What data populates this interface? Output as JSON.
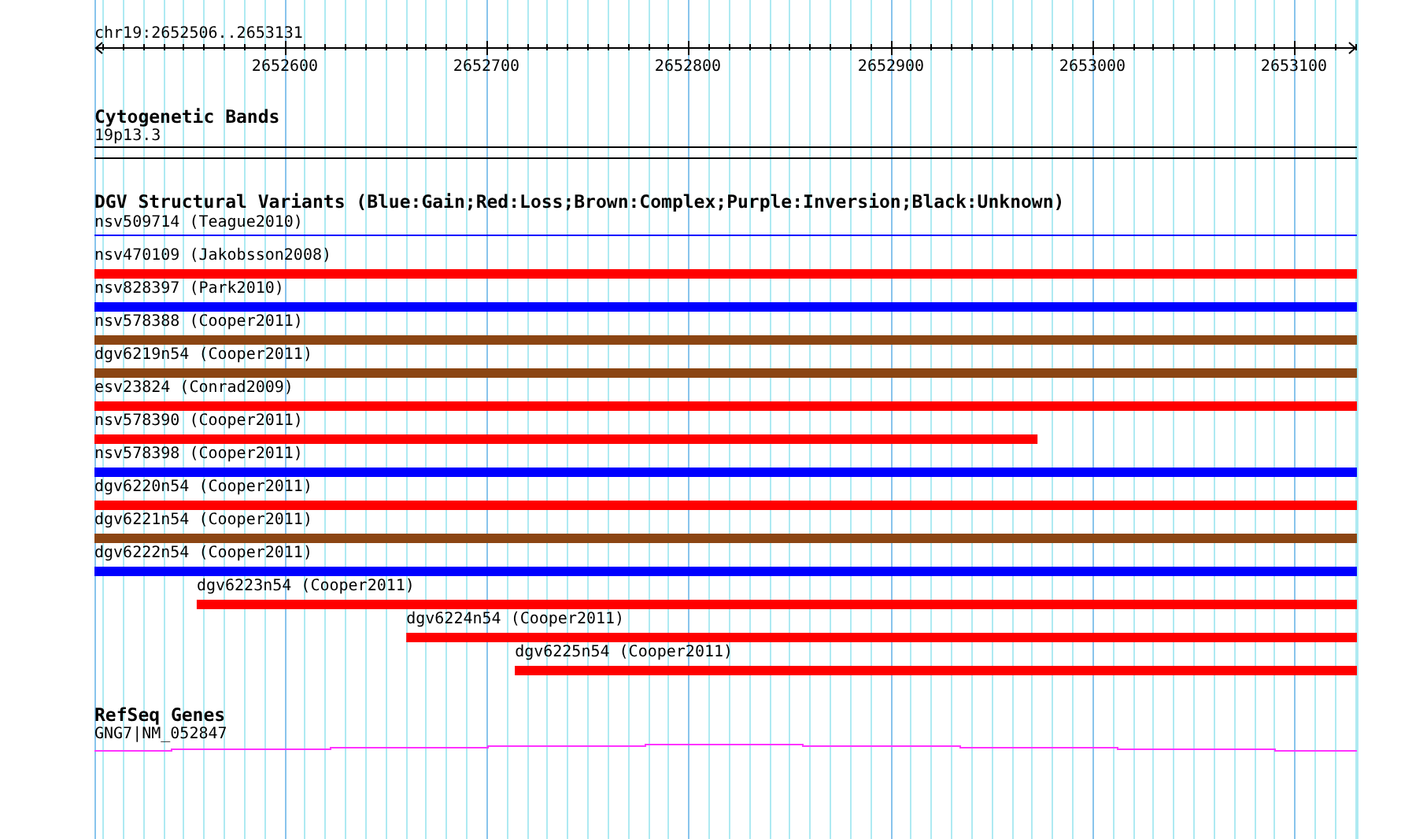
{
  "ruler": {
    "position_label": "chr19:2652506..2653131",
    "tick_labels": [
      "2652600",
      "2652700",
      "2652800",
      "2652900",
      "2653000",
      "2653100"
    ]
  },
  "cytogenetic_bands": {
    "title": "Cytogenetic Bands",
    "band_label": "19p13.3"
  },
  "dgv_track": {
    "title": "DGV Structural Variants (Blue:Gain;Red:Loss;Brown:Complex;Purple:Inversion;Black:Unknown)",
    "features": [
      {
        "label": "nsv509714 (Teague2010)",
        "kind": "line",
        "color": "#0000ff",
        "level": 1
      },
      {
        "label": "nsv470109 (Jakobsson2008)",
        "kind": "bar",
        "color": "#ff0000",
        "level": 1
      },
      {
        "label": "nsv828397 (Park2010)",
        "kind": "bar",
        "color": "#0000ff",
        "level": 1
      },
      {
        "label": "nsv578388 (Cooper2011)",
        "kind": "bar",
        "color": "#8b4513",
        "level": 1
      },
      {
        "label": "dgv6219n54 (Cooper2011)",
        "kind": "bar",
        "color": "#8b4513",
        "level": 1
      },
      {
        "label": "esv23824 (Conrad2009)",
        "kind": "bar",
        "color": "#ff0000",
        "level": 1
      },
      {
        "label": "nsv578390 (Cooper2011)",
        "kind": "bar",
        "color": "#ff0000",
        "right_aligned": false,
        "level": 0.747
      },
      {
        "label": "nsv578398 (Cooper2011)",
        "kind": "bar",
        "color": "#0000ff",
        "level": 1
      },
      {
        "label": "dgv6220n54 (Cooper2011)",
        "kind": "bar",
        "color": "#ff0000",
        "level": 1
      },
      {
        "label": "dgv6221n54 (Cooper2011)",
        "kind": "bar",
        "color": "#8b4513",
        "level": 1
      },
      {
        "label": "dgv6222n54 (Cooper2011)",
        "kind": "bar",
        "color": "#0000ff",
        "level": 1
      },
      {
        "label": "dgv6223n54 (Cooper2011)",
        "kind": "bar",
        "color": "#ff0000",
        "right_aligned": true,
        "level": 0.919
      },
      {
        "label": "dgv6224n54 (Cooper2011)",
        "kind": "bar",
        "color": "#ff0000",
        "right_aligned": true,
        "level": 0.753
      },
      {
        "label": "dgv6225n54 (Cooper2011)",
        "kind": "bar",
        "color": "#ff0000",
        "right_aligned": true,
        "level": 0.667
      }
    ]
  },
  "refseq_genes": {
    "title": "RefSeq Genes",
    "gene_label": "GNG7|NM_052847"
  }
}
